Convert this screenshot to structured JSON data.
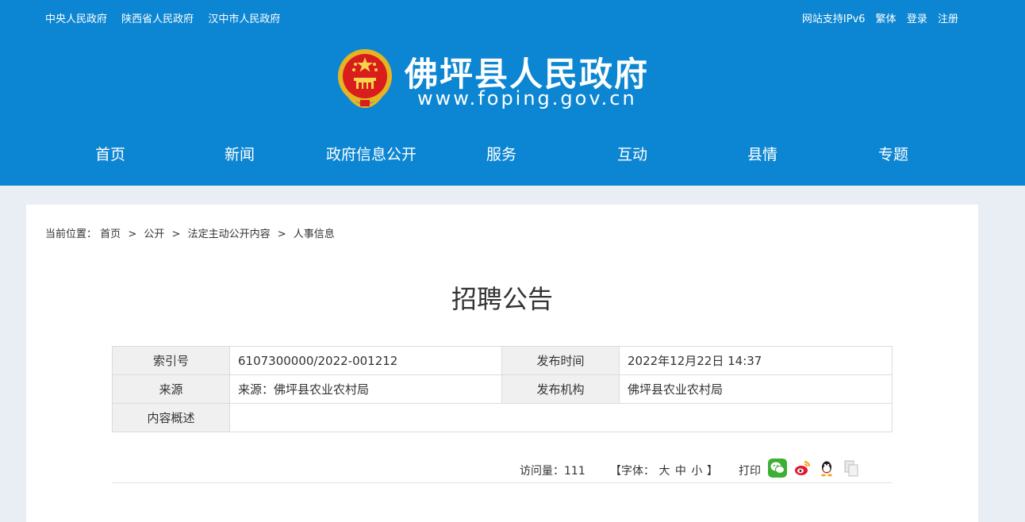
{
  "topbar": {
    "links": [
      "中央人民政府",
      "陕西省人民政府",
      "汉中市人民政府"
    ],
    "right": [
      "网站支持IPv6",
      "繁体",
      "登录",
      "注册"
    ]
  },
  "site": {
    "title": "佛坪县人民政府",
    "url": "www.foping.gov.cn"
  },
  "nav": [
    "首页",
    "新闻",
    "政府信息公开",
    "服务",
    "互动",
    "县情",
    "专题"
  ],
  "breadcrumb": {
    "prefix": "当前位置：",
    "items": [
      "首页",
      "公开",
      "法定主动公开内容",
      "人事信息"
    ],
    "sep": ">"
  },
  "article": {
    "title": "招聘公告",
    "meta": {
      "index_label": "索引号",
      "index_value": "6107300000/2022-001212",
      "time_label": "发布时间",
      "time_value": "2022年12月22日 14:37",
      "source_label": "来源",
      "source_value": "来源：佛坪县农业农村局",
      "org_label": "发布机构",
      "org_value": "佛坪县农业农村局",
      "summary_label": "内容概述",
      "summary_value": ""
    }
  },
  "tools": {
    "visits": "访问量：111",
    "font_prefix": "【字体：",
    "font_sizes": [
      "大",
      "中",
      "小"
    ],
    "font_suffix": "】",
    "print": "打印"
  },
  "colors": {
    "header": "#0c86d2",
    "page_bg": "#e9eef5"
  }
}
